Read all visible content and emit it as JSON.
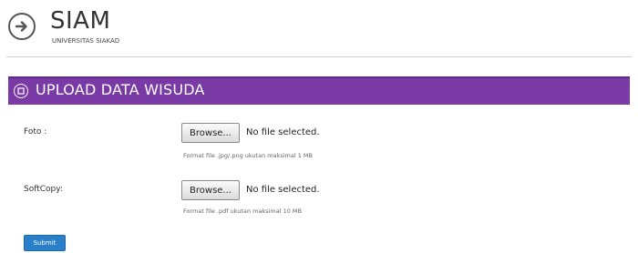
{
  "header": {
    "app_title": "SIAM",
    "app_subtitle": "UNIVERSITAS SIAKAD",
    "logo_icon": "arrow-right-circle-icon"
  },
  "section": {
    "title": "UPLOAD DATA WISUDA",
    "icon": "circle-square-icon",
    "color": "#7a3aa6"
  },
  "form": {
    "foto": {
      "label": "Foto :",
      "button_label": "Browse...",
      "status": "No file selected.",
      "hint": "Format file .jpg/.png ukutan maksimal 1 MB"
    },
    "softcopy": {
      "label": "SoftCopy:",
      "button_label": "Browse...",
      "status": "No file selected.",
      "hint": "Format file .pdf ukutan maksimal 10 MB"
    },
    "submit_label": "Submit",
    "submit_color": "#2a7fc9"
  }
}
